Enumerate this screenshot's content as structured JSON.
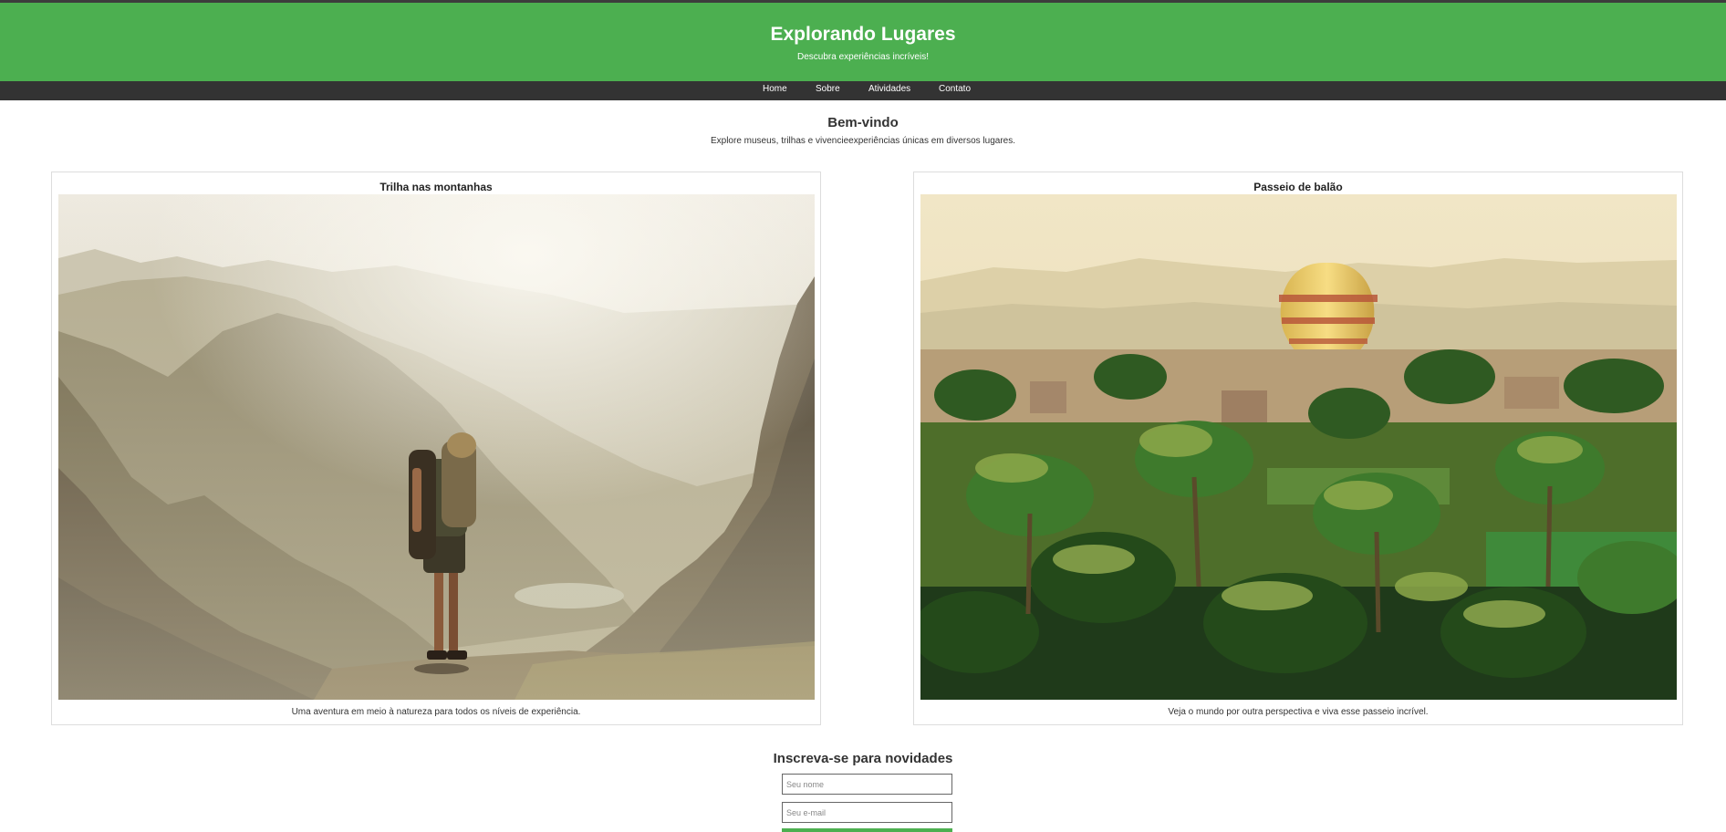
{
  "header": {
    "title": "Explorando Lugares",
    "subtitle": "Descubra experiências incríveis!"
  },
  "nav": {
    "items": [
      {
        "label": "Home"
      },
      {
        "label": "Sobre"
      },
      {
        "label": "Atividades"
      },
      {
        "label": "Contato"
      }
    ]
  },
  "welcome": {
    "title": "Bem-vindo",
    "text": "Explore museus, trilhas e vivencieexperiências únicas em diversos lugares."
  },
  "cards": [
    {
      "title": "Trilha nas montanhas",
      "image": "hiker-in-mountains-photo",
      "description": "Uma aventura em meio à natureza para todos os níveis de experiência."
    },
    {
      "title": "Passeio de balão",
      "image": "hot-air-balloon-over-palms-photo",
      "description": "Veja o mundo por outra perspectiva e viva esse passeio incrível."
    }
  ],
  "newsletter": {
    "title": "Inscreva-se para novidades",
    "name_placeholder": "Seu nome",
    "email_placeholder": "Seu e-mail",
    "button_label": ""
  },
  "colors": {
    "brand_green": "#4caf50",
    "nav_dark": "#333333"
  }
}
